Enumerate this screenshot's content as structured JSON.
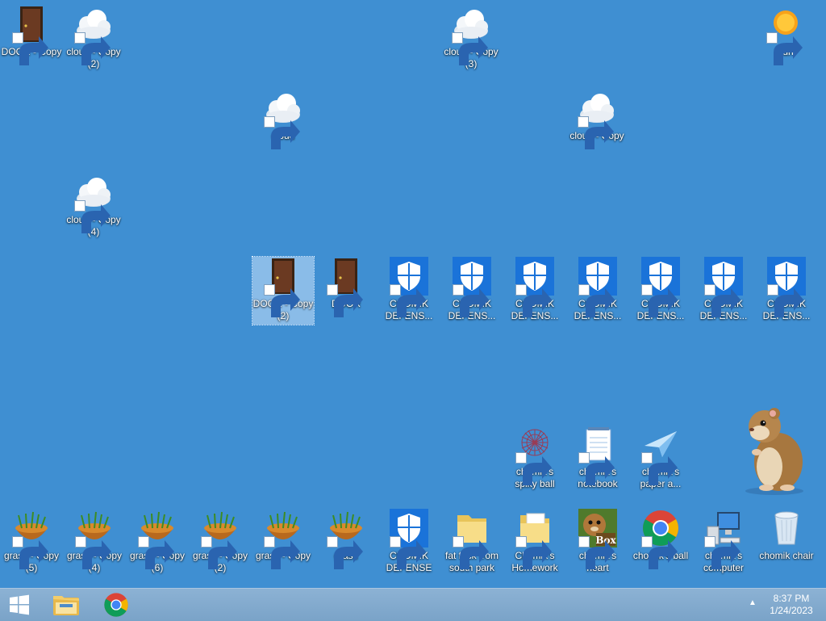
{
  "desktop": {
    "icons": [
      {
        "kind": "door",
        "label": "DOOR - Copy",
        "label2": ""
      },
      {
        "kind": "cloud",
        "label": "cloud - Copy",
        "label2": "(2)"
      },
      {
        "kind": "cloud",
        "label": "cloud - Copy",
        "label2": "(3)"
      },
      {
        "kind": "sun",
        "label": "sun",
        "label2": ""
      },
      {
        "kind": "cloud",
        "label": "cloud",
        "label2": ""
      },
      {
        "kind": "cloud",
        "label": "cloud - Copy",
        "label2": ""
      },
      {
        "kind": "cloud",
        "label": "cloud - Copy",
        "label2": "(4)"
      },
      {
        "kind": "door",
        "label": "DOOR - Copy",
        "label2": "(2)"
      },
      {
        "kind": "door",
        "label": "DOOR",
        "label2": ""
      },
      {
        "kind": "shield",
        "label": "CHOMIK",
        "label2": "DEFENS..."
      },
      {
        "kind": "shield",
        "label": "CHOMIK",
        "label2": "DEFENS..."
      },
      {
        "kind": "shield",
        "label": "CHOMIK",
        "label2": "DEFENS..."
      },
      {
        "kind": "shield",
        "label": "CHOMIK",
        "label2": "DEFENS..."
      },
      {
        "kind": "shield",
        "label": "CHOMIK",
        "label2": "DEFENS..."
      },
      {
        "kind": "shield",
        "label": "CHOMIK",
        "label2": "DEFENS..."
      },
      {
        "kind": "shield",
        "label": "CHOMIK",
        "label2": "DEFENS..."
      },
      {
        "kind": "spiky",
        "label": "chomik's",
        "label2": "spiky ball"
      },
      {
        "kind": "notebook",
        "label": "chomik's",
        "label2": "notebook"
      },
      {
        "kind": "plane",
        "label": "chomik's",
        "label2": "paper a..."
      },
      {
        "kind": "grass",
        "label": "grass - Copy",
        "label2": "(5)"
      },
      {
        "kind": "grass",
        "label": "grass - Copy",
        "label2": "(4)"
      },
      {
        "kind": "grass",
        "label": "grass - Copy",
        "label2": "(6)"
      },
      {
        "kind": "grass",
        "label": "grass - Copy",
        "label2": "(2)"
      },
      {
        "kind": "grass",
        "label": "grass - Copy",
        "label2": ""
      },
      {
        "kind": "grass",
        "label": "grass",
        "label2": ""
      },
      {
        "kind": "shield",
        "label": "CHOMIK",
        "label2": "DEFENSE"
      },
      {
        "kind": "folder",
        "label": "fat fuck from",
        "label2": "south park"
      },
      {
        "kind": "folderdoc",
        "label": "Chomik's",
        "label2": "Homework"
      },
      {
        "kind": "box",
        "label": "chomik's",
        "label2": "heart",
        "box_text": "Box"
      },
      {
        "kind": "chrome",
        "label": "chomik's ball",
        "label2": ""
      },
      {
        "kind": "computer",
        "label": "chomik's",
        "label2": "computer"
      },
      {
        "kind": "bin",
        "label": "chomik chair",
        "label2": ""
      }
    ]
  },
  "taskbar": {
    "time": "8:37 PM",
    "date": "1/24/2023",
    "tray_chevron": "▲"
  },
  "colors": {
    "desktop": "#3f8fd2",
    "taskbar": "#86aed1",
    "shield": "#1a73d9"
  }
}
